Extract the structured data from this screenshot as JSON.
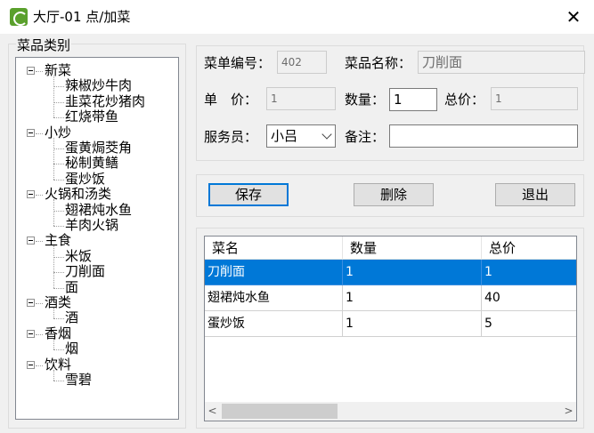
{
  "window": {
    "title": "大厅-01  点/加菜",
    "close_label": "✕"
  },
  "category_group": {
    "label": "菜品类别",
    "tree": [
      {
        "label": "新菜",
        "children": [
          "辣椒炒牛肉",
          "韭菜花炒猪肉",
          "红烧带鱼"
        ]
      },
      {
        "label": "小炒",
        "children": [
          "蛋黄焗茭角",
          "秘制黄鳝",
          "蛋炒饭"
        ]
      },
      {
        "label": "火锅和汤类",
        "children": [
          "翅裙炖水鱼",
          "羊肉火锅"
        ]
      },
      {
        "label": "主食",
        "children": [
          "米饭",
          "刀削面",
          "面"
        ]
      },
      {
        "label": "酒类",
        "children": [
          "酒"
        ]
      },
      {
        "label": "香烟",
        "children": [
          "烟"
        ]
      },
      {
        "label": "饮料",
        "children": [
          "雪碧"
        ]
      }
    ]
  },
  "form": {
    "menu_no_label": "菜单编号：",
    "menu_no_value": "402",
    "dish_name_label": "菜品名称：",
    "dish_name_value": "刀削面",
    "unit_price_label": "单　价：",
    "unit_price_value": "1",
    "quantity_label": "数量：",
    "quantity_value": "1",
    "total_label": "总价：",
    "total_value": "1",
    "waiter_label": "服务员：",
    "waiter_value": "小吕",
    "remark_label": "备注：",
    "remark_value": ""
  },
  "buttons": {
    "save": "保存",
    "delete": "删除",
    "exit": "退出"
  },
  "grid": {
    "columns": [
      "菜名",
      "数量",
      "总价"
    ],
    "rows": [
      [
        "刀削面",
        "1",
        "1"
      ],
      [
        "翅裙炖水鱼",
        "1",
        "40"
      ],
      [
        "蛋炒饭",
        "1",
        "5"
      ]
    ],
    "selected_row": 0
  }
}
